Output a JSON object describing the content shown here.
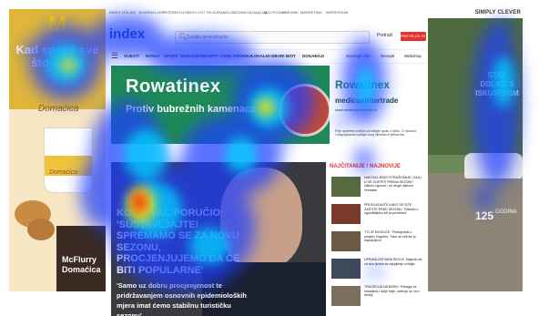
{
  "ad_left": {
    "headline": "Kad spojiš sve što voliš!",
    "logo": "M",
    "script_top": "Domaćica",
    "script_cup": "Domaćica",
    "product_line1": "McFlurry",
    "product_line2": "Domaćica"
  },
  "ad_right": {
    "headline": "STAV DOLAZI S ISKUSTVOM",
    "years": "125",
    "years_sub": "GODINA",
    "tagline": "SIMPLY CLEVER"
  },
  "site": {
    "topnav": [
      "INDEX",
      "OGLASI",
      "JUTARNJI LIST",
      "VEČERNJI LIST",
      "NOVI LIST",
      "TELEGRAM",
      "SLOBODNA DALMACIJA",
      "MOJ POSAO",
      "DNEVNIK",
      "MARKETING",
      "IMPRESSUM"
    ],
    "logo": "index",
    "search_placeholder": "Google pretraživanje",
    "email_label": "Pretraži",
    "subscribe_label": "PRETPLATI SE",
    "nav_items": [
      "VIJESTI",
      "NOVAC",
      "SPORT",
      "MAGAZIN",
      "RECEPTI",
      "CRNA KRONIKA",
      "LOKALNI IZBORI",
      "BIOT",
      "DOGAĐAJI"
    ],
    "nav_right": [
      "Saznajte više",
      "Recepti",
      "Webshop"
    ]
  },
  "banner": {
    "brand": "Rowatinex",
    "tagline": "Protiv bubrežnih kamenaca",
    "pre": "Rowatinex",
    "website": "medicusintertrade",
    "website_sub": "www.medicusintertrade.hr",
    "fine": "Prije upotrebe pažljivo pročitajte uputu o lijeku. O rizicima i nuspojavama upitajte svog liječnika ili ljekarnika."
  },
  "lead": {
    "headline": "KOZLEVAC PORUČIO: 'SUSTAVLJAJTE! SPREMAMO SE ZA NOVU SEZONU, PROCJENJUJEMO DA ĆE BITI POPULARNE'",
    "subhead": "'Samo uz dobru procjenjenost te pridržavanjem osnovnih epidemioloških mjera imat ćemo stabilnu turističku sezonu'..."
  },
  "news": {
    "heading": "NAJČITANIJE / NAJNOVIJE",
    "items": [
      {
        "text": "NASTAVLJENO ISTRAŽIVANJE: DAJU LI SE CIJEPITI PREMA SEZONI? Uskoro ugovori i za druge dijelove Hrvatske",
        "color": "#556b3e"
      },
      {
        "text": "PROGLEDAJTE KAKO SE SITE ZAŠTITE PRED SEZONU. 'Radnici u ugostiteljstvu bit će prioritetni'",
        "color": "#7a3a2a"
      },
      {
        "text": "'TO JE MOGUĆE'. Predsjednik u posjetu Zagrebu: 'Tako se vidi što je napravljeno'",
        "color": "#6a5a44"
      },
      {
        "text": "UPRAVA ZATVARA ŠKOLE. Najavili rok od dva tjedna za cijepljenje učitelja",
        "color": "#3e4a5a"
      },
      {
        "text": "TRAGEDIJA NA MORU: Potraga za nestalima i dalje traje, očekuju se novi detalji",
        "color": "#7c6e5e"
      }
    ]
  },
  "heat_colors": {
    "low": "#1f3dff",
    "mid": "#00d5ff",
    "high": "#ffe600",
    "peak": "#ff2200"
  }
}
